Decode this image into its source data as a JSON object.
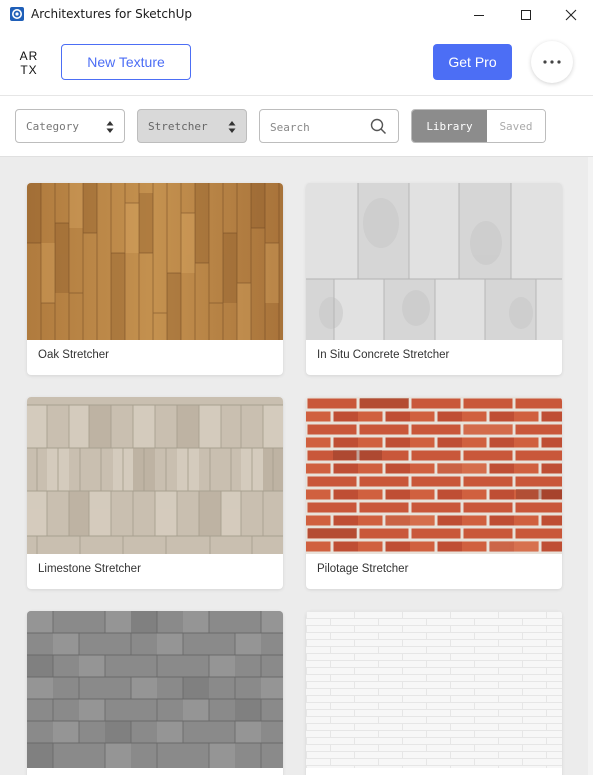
{
  "window": {
    "title": "Architextures for SketchUp"
  },
  "header": {
    "logo_top": "AR",
    "logo_bottom": "TX",
    "new_texture_label": "New Texture",
    "get_pro_label": "Get Pro"
  },
  "filters": {
    "category_label": "Category",
    "stretcher_label": "Stretcher",
    "search_placeholder": "Search",
    "library_label": "Library",
    "saved_label": "Saved"
  },
  "colors": {
    "accent": "#4c6ef5",
    "toggle_active": "#8c8c8c",
    "content_bg": "#ececec"
  },
  "textures": [
    {
      "name": "Oak Stretcher",
      "material": "wood"
    },
    {
      "name": "In Situ Concrete Stretcher",
      "material": "concrete"
    },
    {
      "name": "Limestone Stretcher",
      "material": "limestone"
    },
    {
      "name": "Pilotage Stretcher",
      "material": "red-brick"
    },
    {
      "name": "",
      "material": "grey-stone"
    },
    {
      "name": "",
      "material": "white-brick"
    }
  ]
}
